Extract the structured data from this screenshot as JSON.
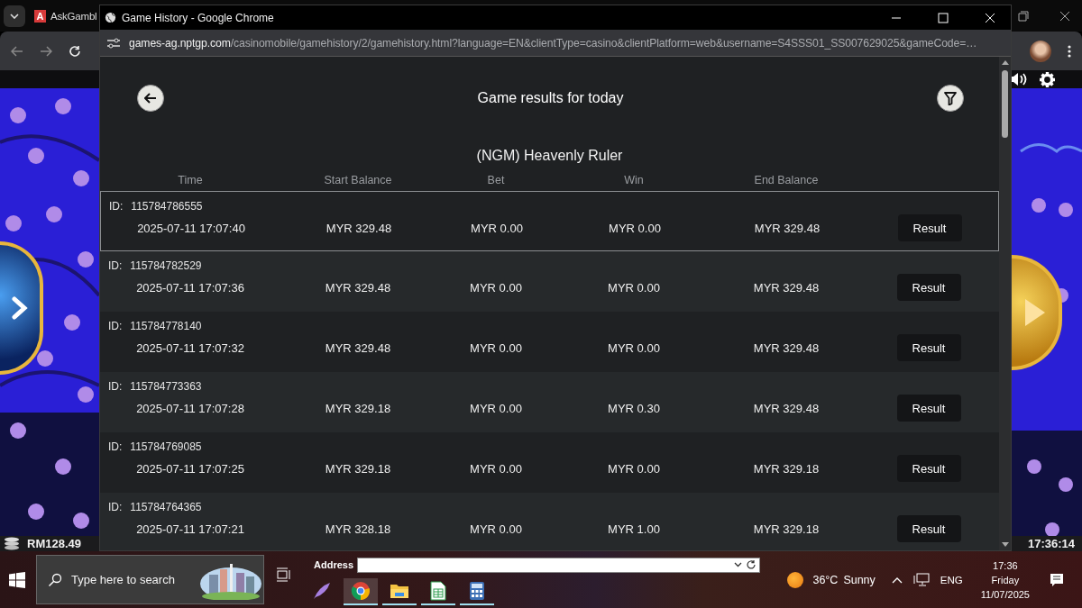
{
  "background_browser": {
    "tab": {
      "favicon_letter": "A",
      "title": "AskGambl"
    }
  },
  "game": {
    "balance": "RM128.49",
    "clock": "17:36:14"
  },
  "popup": {
    "title": "Game History - Google Chrome",
    "url_host": "games-ag.nptgp.com",
    "url_path": "/casinomobile/gamehistory/2/gamehistory.html?language=EN&clientType=casino&clientPlatform=web&username=S4SSS01_SS007629025&gameCode=…",
    "heading": "Game results for today",
    "game_name": "(NGM) Heavenly Ruler",
    "columns": [
      "Time",
      "Start Balance",
      "Bet",
      "Win",
      "End Balance"
    ],
    "rows": [
      {
        "selected": true,
        "id_label": "ID:",
        "id": "115784786555",
        "time": "2025-07-11 17:07:40",
        "start": "MYR 329.48",
        "bet": "MYR 0.00",
        "win": "MYR 0.00",
        "end": "MYR 329.48",
        "action": "Result"
      },
      {
        "selected": false,
        "id_label": "ID:",
        "id": "115784782529",
        "time": "2025-07-11 17:07:36",
        "start": "MYR 329.48",
        "bet": "MYR 0.00",
        "win": "MYR 0.00",
        "end": "MYR 329.48",
        "action": "Result"
      },
      {
        "selected": false,
        "id_label": "ID:",
        "id": "115784778140",
        "time": "2025-07-11 17:07:32",
        "start": "MYR 329.48",
        "bet": "MYR 0.00",
        "win": "MYR 0.00",
        "end": "MYR 329.48",
        "action": "Result"
      },
      {
        "selected": false,
        "id_label": "ID:",
        "id": "115784773363",
        "time": "2025-07-11 17:07:28",
        "start": "MYR 329.18",
        "bet": "MYR 0.00",
        "win": "MYR 0.30",
        "end": "MYR 329.48",
        "action": "Result"
      },
      {
        "selected": false,
        "id_label": "ID:",
        "id": "115784769085",
        "time": "2025-07-11 17:07:25",
        "start": "MYR 329.18",
        "bet": "MYR 0.00",
        "win": "MYR 0.00",
        "end": "MYR 329.18",
        "action": "Result"
      },
      {
        "selected": false,
        "id_label": "ID:",
        "id": "115784764365",
        "time": "2025-07-11 17:07:21",
        "start": "MYR 328.18",
        "bet": "MYR 0.00",
        "win": "MYR 1.00",
        "end": "MYR 329.18",
        "action": "Result"
      }
    ]
  },
  "taskbar": {
    "search": {
      "placeholder": "Type here to search"
    },
    "address_label": "Address",
    "apps": [
      {
        "kind": "feather",
        "selected": false,
        "running": false
      },
      {
        "kind": "chrome",
        "selected": true,
        "running": true
      },
      {
        "kind": "folder",
        "selected": false,
        "running": true
      },
      {
        "kind": "sheet",
        "selected": false,
        "running": true
      },
      {
        "kind": "calculator",
        "selected": false,
        "running": true
      }
    ],
    "weather": {
      "temperature": "36°C",
      "condition": "Sunny"
    },
    "language": "ENG",
    "time": "17:36",
    "day": "Friday",
    "date": "11/07/2025"
  }
}
